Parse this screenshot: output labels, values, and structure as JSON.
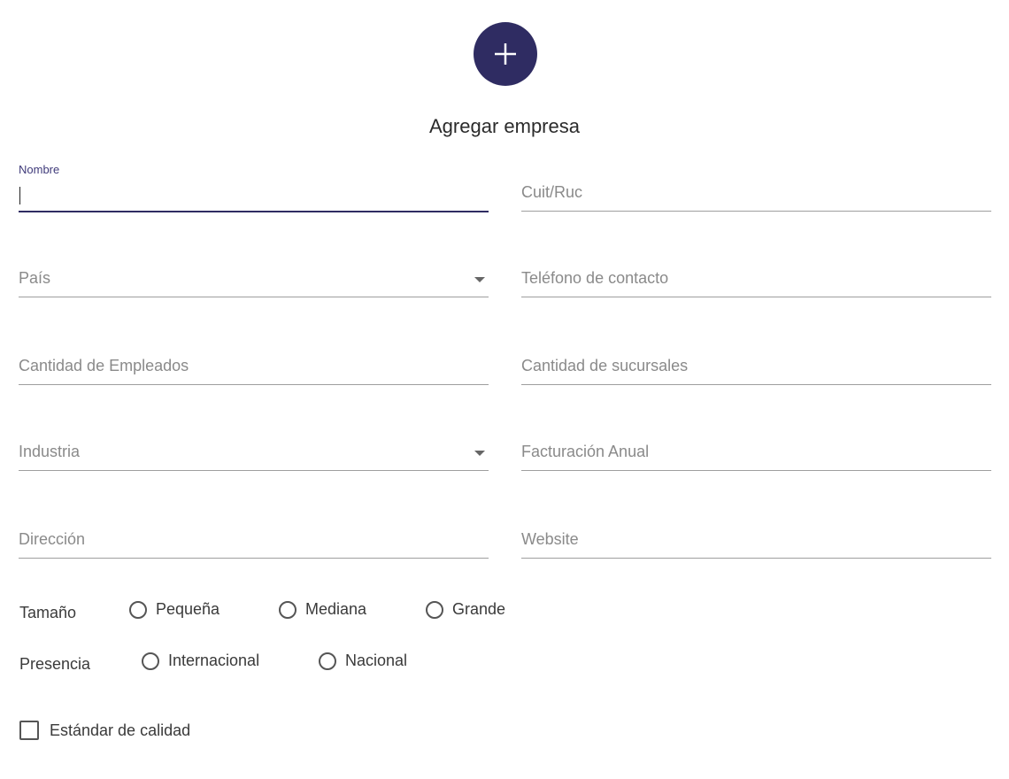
{
  "header": {
    "add_icon": "plus-icon",
    "accent_color": "#2f2c62",
    "title": "Agregar empresa"
  },
  "form": {
    "nombre": {
      "label": "Nombre",
      "value": ""
    },
    "cuit": {
      "label": "Cuit/Ruc",
      "value": ""
    },
    "pais": {
      "label": "País",
      "value": ""
    },
    "telefono": {
      "label": "Teléfono de contacto",
      "value": ""
    },
    "empleados": {
      "label": "Cantidad de Empleados",
      "value": ""
    },
    "sucursales": {
      "label": "Cantidad de sucursales",
      "value": ""
    },
    "industria": {
      "label": "Industria",
      "value": ""
    },
    "facturacion": {
      "label": "Facturación Anual",
      "value": ""
    },
    "direccion": {
      "label": "Dirección",
      "value": ""
    },
    "website": {
      "label": "Website",
      "value": ""
    }
  },
  "tamano": {
    "label": "Tamaño",
    "options": [
      "Pequeña",
      "Mediana",
      "Grande"
    ],
    "selected": null
  },
  "presencia": {
    "label": "Presencia",
    "options": [
      "Internacional",
      "Nacional"
    ],
    "selected": null
  },
  "calidad": {
    "label": "Estándar de calidad",
    "checked": false
  }
}
